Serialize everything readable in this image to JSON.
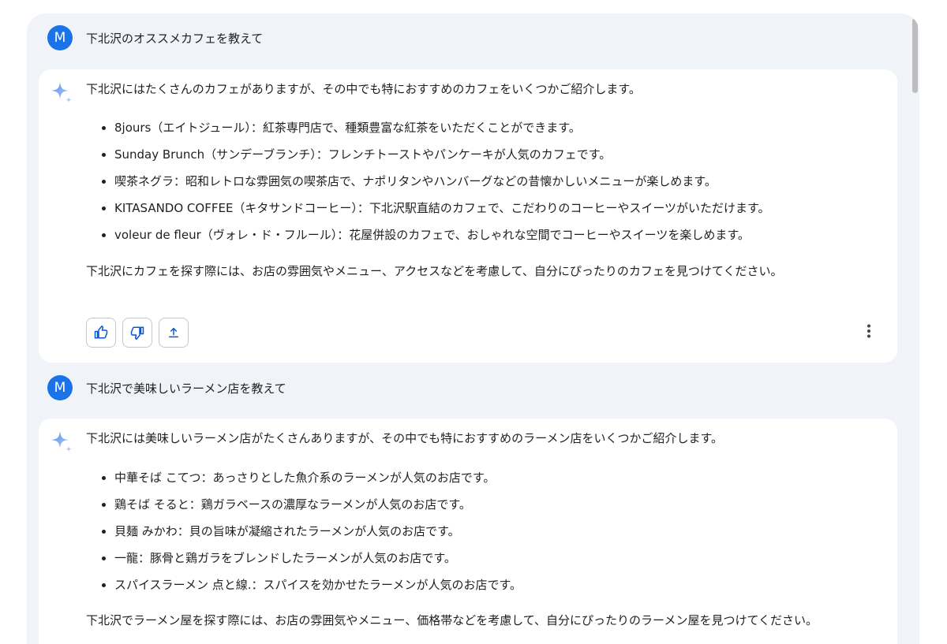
{
  "conversation": {
    "turn1": {
      "user": {
        "avatar_letter": "M",
        "prompt": "下北沢のオススメカフェを教えて"
      },
      "response": {
        "intro": "下北沢にはたくさんのカフェがありますが、その中でも特におすすめのカフェをいくつかご紹介します。",
        "items": [
          "8jours（エイトジュール）：紅茶専門店で、種類豊富な紅茶をいただくことができます。",
          "Sunday Brunch（サンデーブランチ）：フレンチトーストやパンケーキが人気のカフェです。",
          "喫茶ネグラ：昭和レトロな雰囲気の喫茶店で、ナポリタンやハンバーグなどの昔懐かしいメニューが楽しめます。",
          "KITASANDO COFFEE（キタサンドコーヒー）：下北沢駅直結のカフェで、こだわりのコーヒーやスイーツがいただけます。",
          "voleur de fleur（ヴォレ・ド・フルール）：花屋併設のカフェで、おしゃれな空間でコーヒーやスイーツを楽しめます。"
        ],
        "outro": "下北沢にカフェを探す際には、お店の雰囲気やメニュー、アクセスなどを考慮して、自分にぴったりのカフェを見つけてください。",
        "action_icons": [
          "thumbs-up-icon",
          "thumbs-down-icon",
          "share-icon",
          "more-vert-icon"
        ]
      }
    },
    "turn2": {
      "user": {
        "avatar_letter": "M",
        "prompt": "下北沢で美味しいラーメン店を教えて"
      },
      "response": {
        "intro": "下北沢には美味しいラーメン店がたくさんありますが、その中でも特におすすめのラーメン店をいくつかご紹介します。",
        "items": [
          "中華そば こてつ：あっさりとした魚介系のラーメンが人気のお店です。",
          "鶏そば そると：鶏ガラベースの濃厚なラーメンが人気のお店です。",
          "貝麺 みかわ：貝の旨味が凝縮されたラーメンが人気のお店です。",
          "一龍：豚骨と鶏ガラをブレンドしたラーメンが人気のお店です。",
          "スパイスラーメン 点と線.：スパイスを効かせたラーメンが人気のお店です。"
        ],
        "outro": "下北沢でラーメン屋を探す際には、お店の雰囲気やメニュー、価格帯などを考慮して、自分にぴったりのラーメン屋を見つけてください。"
      }
    }
  },
  "colors": {
    "panel_bg": "#f0f4f9",
    "card_bg": "#ffffff",
    "avatar_bg": "#1a73e8",
    "action_icon": "#0b57d0",
    "spark_gradient": [
      "#4f8df5",
      "#b7c9f5"
    ]
  }
}
